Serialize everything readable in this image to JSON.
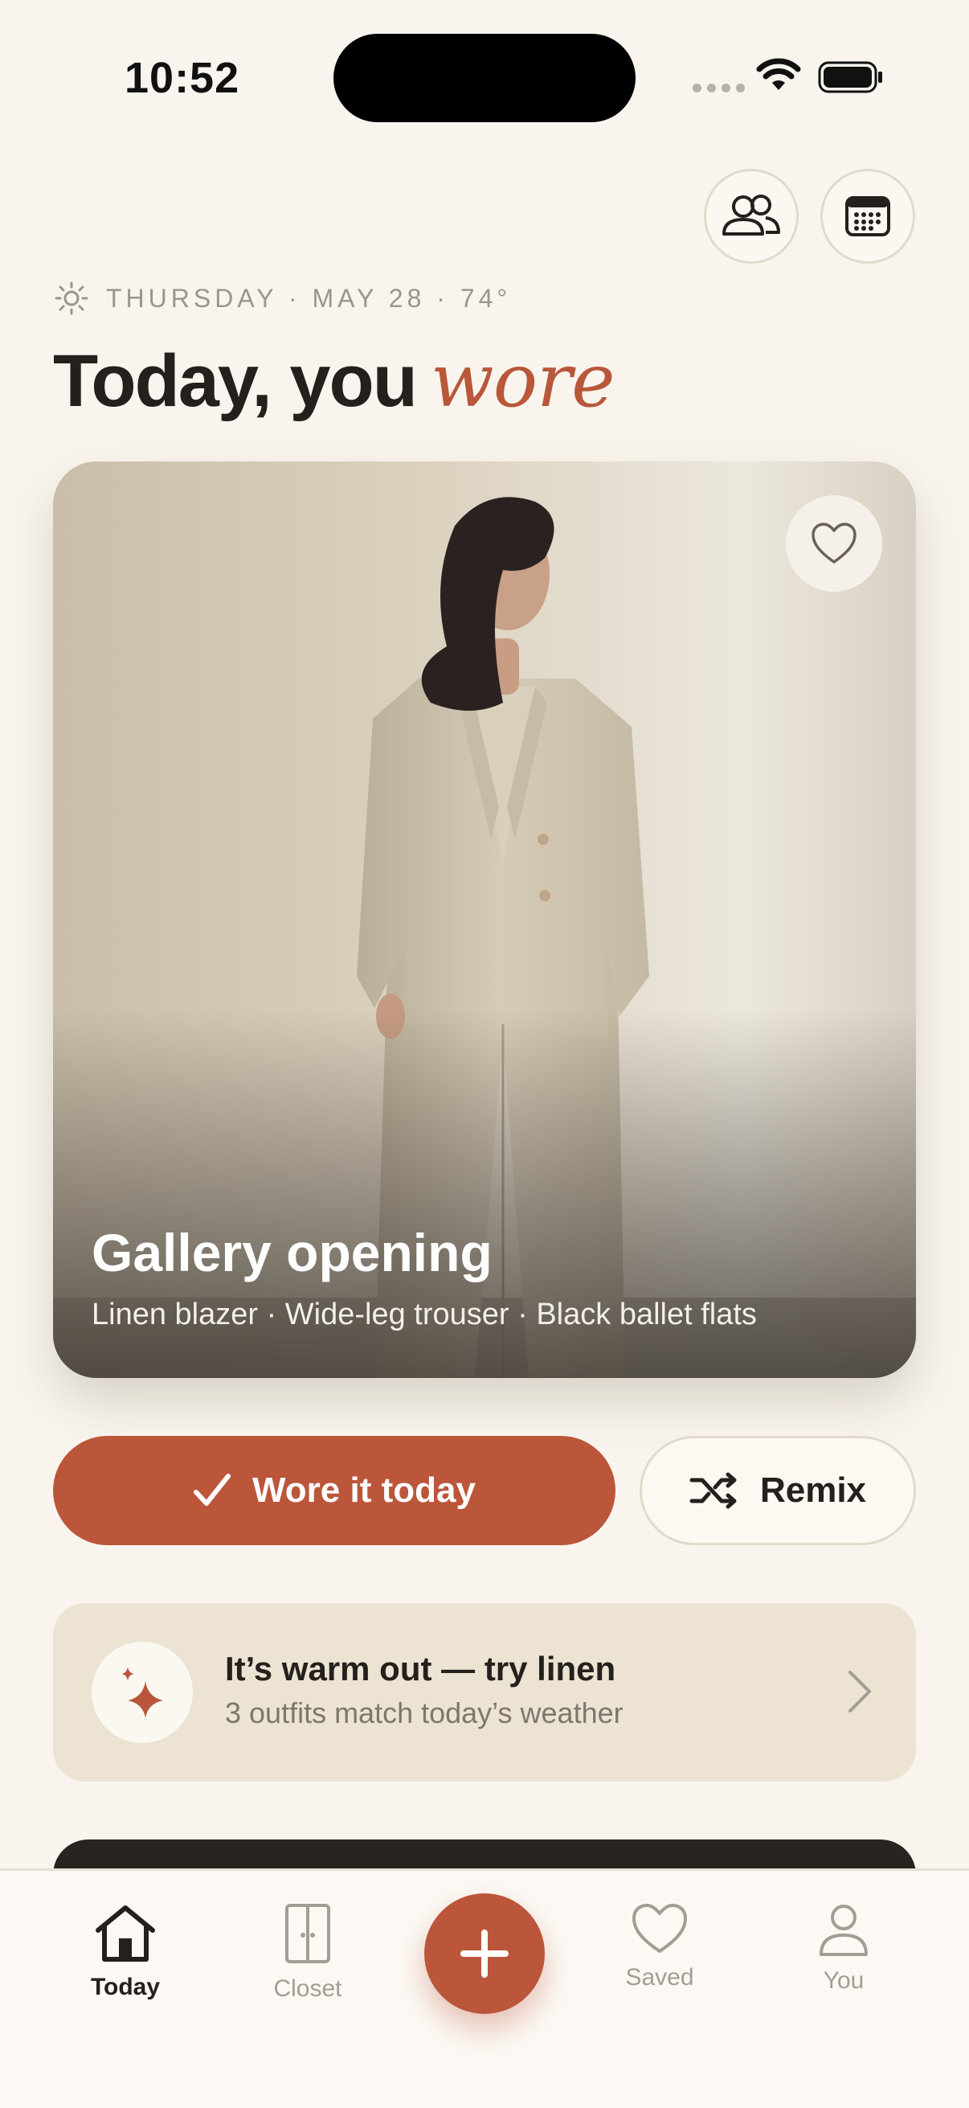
{
  "status_bar": {
    "time": "10:52"
  },
  "date_line": {
    "text": "THURSDAY · MAY 28 · 74°",
    "icon": "sun-icon"
  },
  "heading": {
    "prefix": "Today, you",
    "accent": "wore"
  },
  "hero": {
    "title": "Gallery opening",
    "items": "Linen blazer · Wide-leg trouser · Black ballet flats",
    "favorite_icon": "heart-icon"
  },
  "actions": {
    "wore_label": "Wore it today",
    "remix_label": "Remix"
  },
  "suggestion": {
    "title": "It’s warm out — try linen",
    "subtitle": "3 outfits match today’s weather",
    "icon": "sparkle-icon"
  },
  "tabbar": {
    "tabs": [
      {
        "label": "Today",
        "icon": "home-icon",
        "active": true
      },
      {
        "label": "Closet",
        "icon": "wardrobe-icon",
        "active": false
      },
      {
        "label": "Saved",
        "icon": "heart-icon",
        "active": false
      },
      {
        "label": "You",
        "icon": "person-icon",
        "active": false
      }
    ],
    "add_icon": "plus-icon"
  },
  "colors": {
    "accent": "#bb563b",
    "background": "#f9f5ee",
    "text": "#24201c",
    "muted": "#9b958c",
    "suggestion_bg": "#ece3d3"
  }
}
